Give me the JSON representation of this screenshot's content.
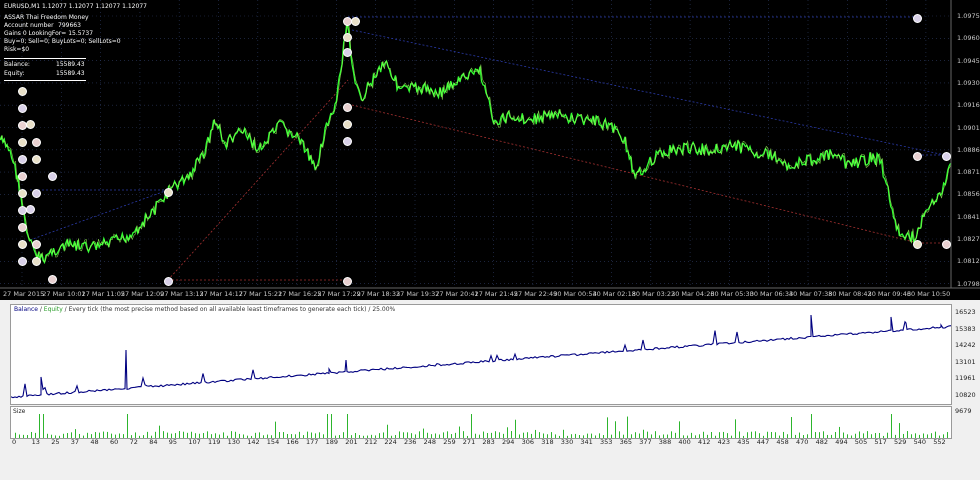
{
  "header": {
    "symbol_line": "EURUSD,M1  1.12077 1.12077 1.12077 1.12077",
    "ea_name": "ASSAR Thai Freedom Money",
    "account_label": "Account number",
    "account_value": "799663",
    "gains_line": "Gains 0 LookingFor= 15.5737",
    "orders_line": "Buy=0; Sell=0; BuyLots=0; SellLots=0",
    "risk_line": "Risk=$0"
  },
  "stats": {
    "balance_label": "Balance:",
    "balance_value": "15589.43",
    "equity_label": "Equity:",
    "equity_value": "15589.43"
  },
  "price_axis": [
    "1.09750",
    "1.09605",
    "1.09455",
    "1.09305",
    "1.09160",
    "1.09015",
    "1.08860",
    "1.08715",
    "1.08565",
    "1.08415",
    "1.08270",
    "1.08125",
    "1.07980"
  ],
  "time_axis": [
    "27 Mar 2015",
    "27 Mar 10:01",
    "27 Mar 11:05",
    "27 Mar 12:09",
    "27 Mar 13:13",
    "27 Mar 14:17",
    "27 Mar 15:21",
    "27 Mar 16:25",
    "27 Mar 17:29",
    "27 Mar 18:33",
    "27 Mar 19:37",
    "27 Mar 20:41",
    "27 Mar 21:45",
    "27 Mar 22:49",
    "30 Mar 00:54",
    "30 Mar 02:18",
    "30 Mar 03:22",
    "30 Mar 04:26",
    "30 Mar 05:30",
    "30 Mar 06:34",
    "30 Mar 07:38",
    "30 Mar 08:42",
    "30 Mar 09:46",
    "30 Mar 10:50"
  ],
  "tester": {
    "legend_balance": "Balance",
    "legend_sep1": " / ",
    "legend_equity": "Equity",
    "legend_rest": " / Every tick (the most precise method based on all available least timeframes to generate each tick) / 25.00%",
    "y_axis": [
      "16523",
      "15383",
      "14242",
      "13101",
      "11961",
      "10820",
      "9679"
    ],
    "size_label": "Size",
    "x_axis": [
      "0",
      "13",
      "25",
      "37",
      "48",
      "60",
      "72",
      "84",
      "95",
      "107",
      "119",
      "130",
      "142",
      "154",
      "166",
      "177",
      "189",
      "201",
      "212",
      "224",
      "236",
      "248",
      "259",
      "271",
      "283",
      "294",
      "306",
      "318",
      "330",
      "341",
      "353",
      "365",
      "377",
      "388",
      "400",
      "412",
      "423",
      "435",
      "447",
      "458",
      "470",
      "482",
      "494",
      "505",
      "517",
      "529",
      "540",
      "552"
    ]
  },
  "colors": {
    "price_line": "#33ff33",
    "grid": "#334466",
    "balance_line": "#000080",
    "size_bars": "#2db52d",
    "trade_line_blue": "#2a3aa8",
    "trade_line_red": "#a33030"
  }
}
